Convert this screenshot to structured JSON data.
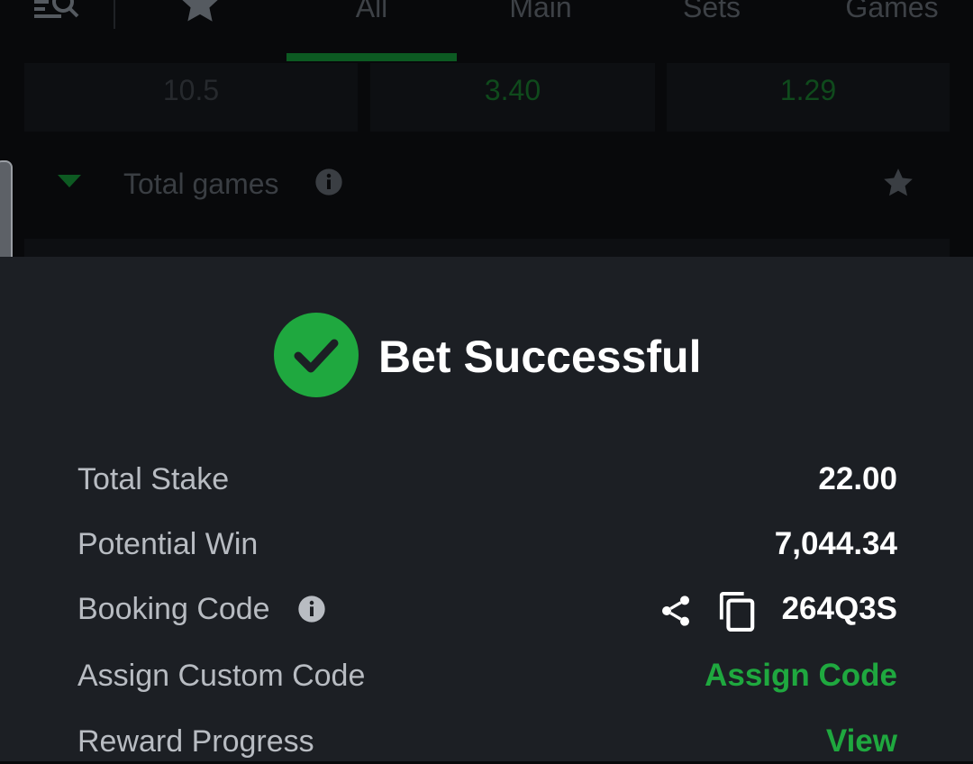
{
  "topnav": {
    "tabs": [
      {
        "label": "All"
      },
      {
        "label": "Main"
      },
      {
        "label": "Sets"
      },
      {
        "label": "Games"
      }
    ]
  },
  "odds": [
    "10.5",
    "3.40",
    "1.29"
  ],
  "market": {
    "title": "Total games"
  },
  "bet": {
    "title": "Bet Successful",
    "rows": [
      {
        "label": "Total Stake",
        "value": "22.00"
      },
      {
        "label": "Potential Win",
        "value": "7,044.34"
      },
      {
        "label": "Booking Code",
        "value": "264Q3S"
      },
      {
        "label": "Assign Custom Code",
        "value": "Assign Code"
      },
      {
        "label": "Reward Progress",
        "value": "View"
      }
    ]
  },
  "colors": {
    "sheet_bg": "#1c1f24",
    "success_green": "#1fa83f",
    "accent_green": "#1fa83f"
  },
  "icons": [
    "search-menu-icon",
    "star-icon",
    "caret-down-icon",
    "info-icon",
    "check-circle-icon",
    "share-icon",
    "copy-icon"
  ]
}
